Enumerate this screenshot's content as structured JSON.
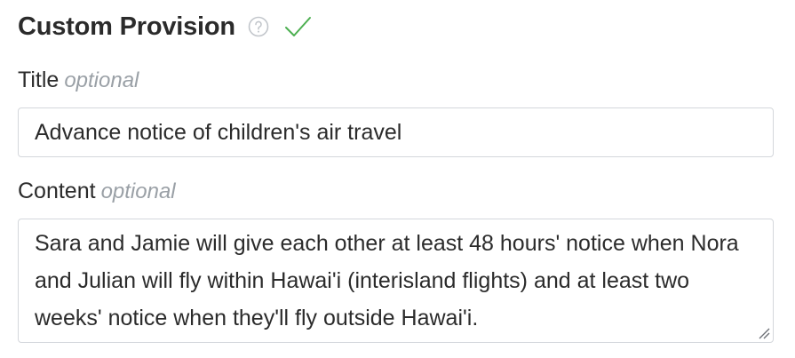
{
  "header": {
    "title": "Custom Provision",
    "help_icon": "question-circle-icon",
    "status_icon": "checkmark-icon",
    "status_color": "#4caf50"
  },
  "fields": {
    "title": {
      "label": "Title",
      "hint": "optional",
      "value": "Advance notice of children's air travel"
    },
    "content": {
      "label": "Content",
      "hint": "optional",
      "value": "Sara and Jamie will give each other at least 48 hours' notice when Nora and Julian will fly within Hawai'i (interisland flights) and at least two weeks' notice when they'll fly outside Hawai'i."
    }
  }
}
